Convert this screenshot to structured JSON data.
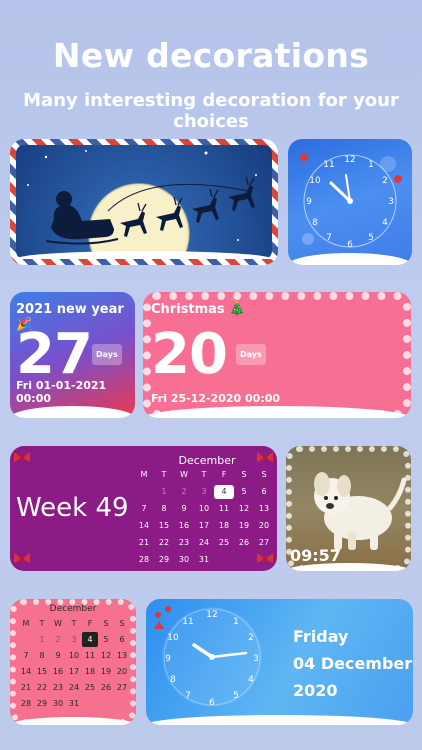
{
  "header": {
    "title": "New decorations",
    "subtitle": "Many interesting decoration for your choices"
  },
  "countdown_new_year": {
    "title": "2021 new year 🎉",
    "number": "27",
    "unit": "Days",
    "date": "Fri 01-01-2021 00:00"
  },
  "countdown_christmas": {
    "title": "Christmas 🎄",
    "number": "20",
    "unit": "Days",
    "date": "Fri 25-12-2020 00:00"
  },
  "week_calendar": {
    "week_label": "Week 49",
    "month": "December",
    "weekdays": [
      "M",
      "T",
      "W",
      "T",
      "F",
      "S",
      "S"
    ],
    "days": [
      "",
      "1",
      "2",
      "3",
      "4",
      "5",
      "6",
      "7",
      "8",
      "9",
      "10",
      "11",
      "12",
      "13",
      "14",
      "15",
      "16",
      "17",
      "18",
      "19",
      "20",
      "21",
      "22",
      "23",
      "24",
      "25",
      "26",
      "27",
      "28",
      "29",
      "30",
      "31"
    ],
    "dim_days": [
      "1",
      "2",
      "3"
    ],
    "today": "4"
  },
  "puppy_widget": {
    "time": "09:57"
  },
  "pink_calendar": {
    "month": "December",
    "weekdays": [
      "M",
      "T",
      "W",
      "T",
      "F",
      "S",
      "S"
    ],
    "days": [
      "",
      "1",
      "2",
      "3",
      "4",
      "5",
      "6",
      "7",
      "8",
      "9",
      "10",
      "11",
      "12",
      "13",
      "14",
      "15",
      "16",
      "17",
      "18",
      "19",
      "20",
      "21",
      "22",
      "23",
      "24",
      "25",
      "26",
      "27",
      "28",
      "29",
      "30",
      "31"
    ],
    "dim_days": [
      "1",
      "2",
      "3"
    ],
    "today": "4"
  },
  "date_widget": {
    "weekday": "Friday",
    "date": "04 December",
    "year": "2020"
  },
  "clock_numbers": [
    "12",
    "1",
    "2",
    "3",
    "4",
    "5",
    "6",
    "7",
    "8",
    "9",
    "10",
    "11"
  ],
  "colors": {
    "christmas_pink": "#f76f92",
    "week_purple": "#8c1b86",
    "clock_blue": "#3f7ce8"
  }
}
